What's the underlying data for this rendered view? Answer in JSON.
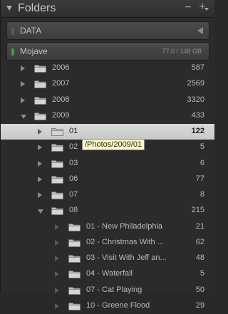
{
  "header": {
    "title": "Folders"
  },
  "volumes": [
    {
      "name": "DATA",
      "led_color": "#5a5a5a",
      "state": "collapsed"
    },
    {
      "name": "Mojave",
      "size": "77.0 / 148 GB",
      "led_color": "#2fa62f",
      "state": "expanded"
    }
  ],
  "tree": [
    {
      "label": "2006",
      "count": "587",
      "level": 0,
      "state": "closed"
    },
    {
      "label": "2007",
      "count": "2569",
      "level": 0,
      "state": "closed"
    },
    {
      "label": "2008",
      "count": "3320",
      "level": 0,
      "state": "closed"
    },
    {
      "label": "2009",
      "count": "433",
      "level": 0,
      "state": "open"
    },
    {
      "label": "01",
      "count": "122",
      "level": 1,
      "state": "closed",
      "selected": true
    },
    {
      "label": "02",
      "count": "5",
      "level": 1,
      "state": "closed"
    },
    {
      "label": "03",
      "count": "6",
      "level": 1,
      "state": "closed"
    },
    {
      "label": "06",
      "count": "77",
      "level": 1,
      "state": "closed"
    },
    {
      "label": "07",
      "count": "8",
      "level": 1,
      "state": "closed"
    },
    {
      "label": "08",
      "count": "215",
      "level": 1,
      "state": "open"
    },
    {
      "label": "01 - New Philadelphia",
      "count": "21",
      "level": 2,
      "state": "dim"
    },
    {
      "label": "02 - Christmas With ...",
      "count": "62",
      "level": 2,
      "state": "dim"
    },
    {
      "label": "03 - Visit With Jeff an...",
      "count": "48",
      "level": 2,
      "state": "dim"
    },
    {
      "label": "04 - Waterfall",
      "count": "5",
      "level": 2,
      "state": "dim"
    },
    {
      "label": "07 - Cat Playing",
      "count": "50",
      "level": 2,
      "state": "dim"
    },
    {
      "label": "10 - Greene Flood",
      "count": "29",
      "level": 2,
      "state": "dim"
    }
  ],
  "tooltip": "/Photos/2009/01",
  "icons": {
    "header_toggle": "disclosure-triangle-icon",
    "remove": "minus-icon",
    "add": "plus-icon",
    "folder": "folder-icon"
  }
}
